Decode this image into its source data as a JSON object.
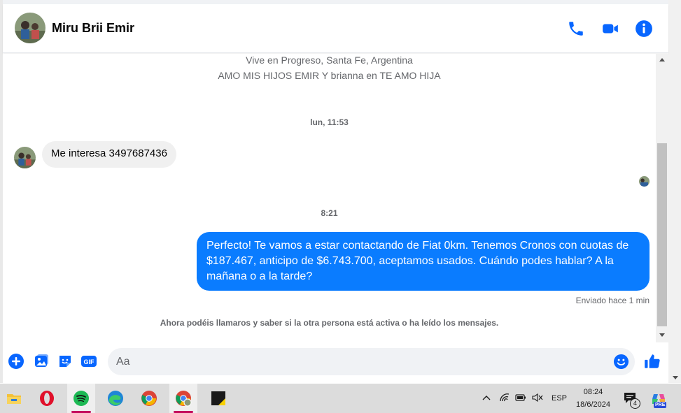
{
  "header": {
    "contact_name": "Miru Brii Emir",
    "accent_color": "#0866ff"
  },
  "profile": {
    "location": "Vive en Progreso, Santa Fe, Argentina",
    "bio": "AMO MIS HIJOS EMIR Y brianna en TE AMO HIJA"
  },
  "messages": [
    {
      "type": "timestamp",
      "text": "lun, 11:53"
    },
    {
      "type": "incoming",
      "text": "Me interesa 3497687436"
    },
    {
      "type": "timestamp",
      "text": "8:21"
    },
    {
      "type": "outgoing",
      "text": "Perfecto! Te vamos a estar contactando de Fiat 0km. Tenemos Cronos con cuotas de $187.467, anticipo de $6.743.700, aceptamos usados. Cuándo podes hablar? A la mañana o a la tarde?"
    }
  ],
  "status": {
    "sent": "Enviado hace 1 min",
    "info": "Ahora podéis llamaros y saber si la otra persona está activa o ha leído los mensajes."
  },
  "composer": {
    "placeholder": "Aa"
  },
  "taskbar": {
    "apps": [
      "file-explorer",
      "opera",
      "spotify",
      "edge",
      "chrome",
      "chrome-profile",
      "sticky-notes"
    ],
    "language": "ESP",
    "time": "08:24",
    "date": "18/6/2024",
    "notification_count": "4",
    "copilot_badge": "PRE"
  }
}
